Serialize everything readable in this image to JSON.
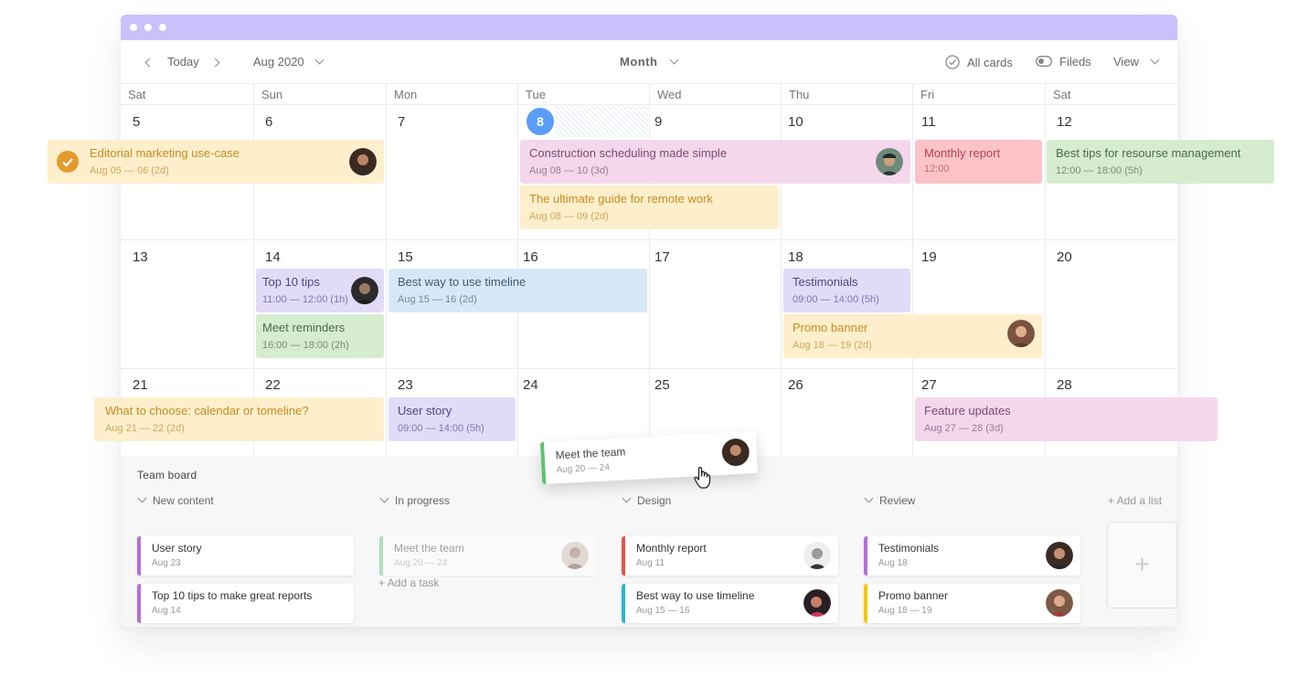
{
  "toolbar": {
    "today": "Today",
    "month_picker": "Aug 2020",
    "view_mode": "Month",
    "all_cards": "All cards",
    "fields": "Fileds",
    "view": "View"
  },
  "weekdays": [
    "Sat",
    "Sun",
    "Mon",
    "Tue",
    "Wed",
    "Thu",
    "Fri",
    "Sat"
  ],
  "weeks": [
    [
      "5",
      "6",
      "7",
      "8",
      "9",
      "10",
      "11",
      "12"
    ],
    [
      "13",
      "14",
      "15",
      "16",
      "17",
      "18",
      "19",
      "20"
    ],
    [
      "21",
      "22",
      "23",
      "24",
      "25",
      "26",
      "27",
      "28"
    ]
  ],
  "events": {
    "editorial": {
      "title": "Editorial marketing use-case",
      "date": "Aug 05 — 06 (2d)"
    },
    "construction": {
      "title": "Construction scheduling made simple",
      "date": "Aug 08 — 10 (3d)"
    },
    "monthly": {
      "title": "Monthly report",
      "date": "12:00"
    },
    "besttips": {
      "title": "Best tips for resourse management",
      "date": "12:00 — 18:00 (5h)"
    },
    "remote": {
      "title": "The ultimate guide for remote work",
      "date": "Aug 08 — 09 (2d)"
    },
    "top10": {
      "title": "Top 10 tips",
      "date": "11:00 — 12:00 (1h)"
    },
    "timeline": {
      "title": "Best way to use timeline",
      "date": "Aug 15 — 16 (2d)"
    },
    "testimonials": {
      "title": "Testimonials",
      "date": "09:00 — 14:00 (5h)"
    },
    "reminders": {
      "title": "Meet reminders",
      "date": "16:00 — 18:00 (2h)"
    },
    "promo": {
      "title": "Promo banner",
      "date": "Aug 18  — 19 (2d)"
    },
    "choose": {
      "title": "What to choose: calendar or tomeline?",
      "date": "Aug 21 — 22 (2d)"
    },
    "userstory": {
      "title": "User story",
      "date": "09:00 — 14:00 (5h)"
    },
    "feature": {
      "title": "Feature updates",
      "date": "Aug 27 — 28 (3d)"
    }
  },
  "dragging": {
    "title": "Meet the team",
    "date": "Aug 20 — 24"
  },
  "board": {
    "title": "Team board",
    "add_list": "+ Add a list",
    "add_task": "+ Add a task",
    "add_icon": "+",
    "columns": [
      {
        "name": "New content",
        "cards": [
          {
            "title": "User story",
            "date": "Aug 23",
            "color": "#b36fd8"
          },
          {
            "title": "Top 10 tips to make great reports",
            "date": "Aug 14",
            "color": "#b36fd8"
          }
        ]
      },
      {
        "name": "In progress",
        "cards": [
          {
            "title": "Meet the team",
            "date": "Aug 20 — 24",
            "color": "#5cc46b"
          }
        ]
      },
      {
        "name": "Design",
        "cards": [
          {
            "title": "Monthly report",
            "date": "Aug 11",
            "color": "#e5534b"
          },
          {
            "title": "Best way to use timeline",
            "date": "Aug 15 — 16",
            "color": "#27b5d6"
          }
        ]
      },
      {
        "name": "Review",
        "cards": [
          {
            "title": "Testimonials",
            "date": "Aug 18",
            "color": "#b36fd8"
          },
          {
            "title": "Promo banner",
            "date": "Aug 18 — 19",
            "color": "#f2c80f"
          }
        ]
      }
    ]
  },
  "colors": {
    "accent": "#c9c1fb",
    "today": "#5b9cf6"
  }
}
